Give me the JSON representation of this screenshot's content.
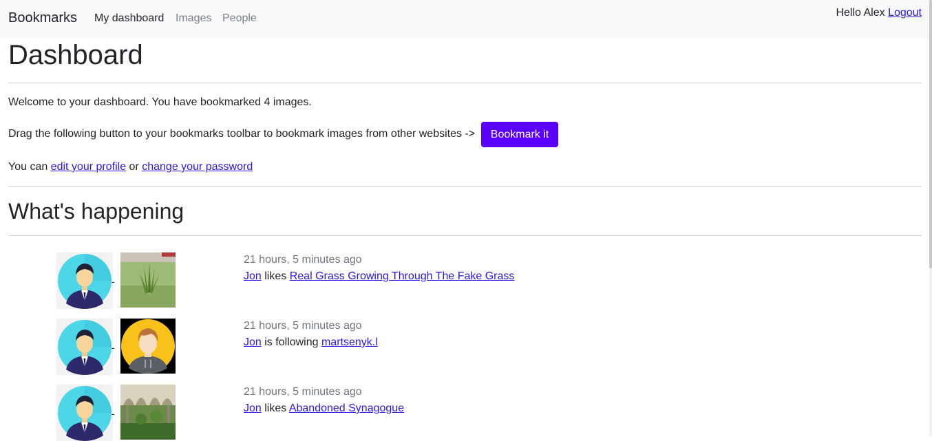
{
  "nav": {
    "brand": "Bookmarks",
    "items": [
      {
        "label": "My dashboard",
        "active": true
      },
      {
        "label": "Images",
        "active": false
      },
      {
        "label": "People",
        "active": false
      }
    ],
    "greeting": "Hello Alex",
    "logout": "Logout"
  },
  "dashboard": {
    "title": "Dashboard",
    "welcome": "Welcome to your dashboard. You have bookmarked 4 images.",
    "drag_text": "Drag the following button to your bookmarks toolbar to bookmark images from other websites ->",
    "bookmark_button": "Bookmark it",
    "profile_prefix": "You can",
    "edit_profile": "edit your profile",
    "or_text": "or",
    "change_password": "change your password"
  },
  "activity": {
    "heading": "What's happening",
    "separator": "-",
    "items": [
      {
        "time": "21 hours, 5 minutes ago",
        "user": "Jon",
        "verb": "likes",
        "target": "Real Grass Growing Through The Fake Grass",
        "target_kind": "image-grass"
      },
      {
        "time": "21 hours, 5 minutes ago",
        "user": "Jon",
        "verb": "is following",
        "target": "martsenyk.l",
        "target_kind": "user-avatar"
      },
      {
        "time": "21 hours, 5 minutes ago",
        "user": "Jon",
        "verb": "likes",
        "target": "Abandoned Synagogue",
        "target_kind": "image-synagogue"
      }
    ]
  },
  "colors": {
    "accent_button": "#5a00ff",
    "link": "#2a17e8",
    "navbar_bg": "#f8f9fa",
    "muted_text": "#6c757d"
  }
}
